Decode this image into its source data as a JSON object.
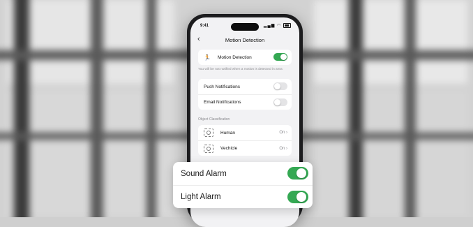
{
  "status_bar": {
    "time": "9:41",
    "signal": "▂▄▆",
    "wifi": "◠"
  },
  "nav": {
    "title": "Motion Detection",
    "back": "‹"
  },
  "motion": {
    "label": "Motion Detection",
    "enabled": true,
    "icon": "running-person-icon"
  },
  "hint": "You will be not notified when a motion is detected in area",
  "notifications": [
    {
      "label": "Push Notifications",
      "enabled": false
    },
    {
      "label": "Email Notifications",
      "enabled": false
    }
  ],
  "object_classification": {
    "section_title": "Object Classification",
    "items": [
      {
        "label": "Human",
        "value": "On",
        "icon": "human-scan-icon"
      },
      {
        "label": "Vechicle",
        "value": "On",
        "icon": "vehicle-scan-icon"
      }
    ]
  },
  "alarms": [
    {
      "label": "Sound Alarm",
      "enabled": true
    },
    {
      "label": "Light Alarm",
      "enabled": true
    }
  ],
  "colors": {
    "accent": "#34a853",
    "background": "#f2f2f4"
  }
}
